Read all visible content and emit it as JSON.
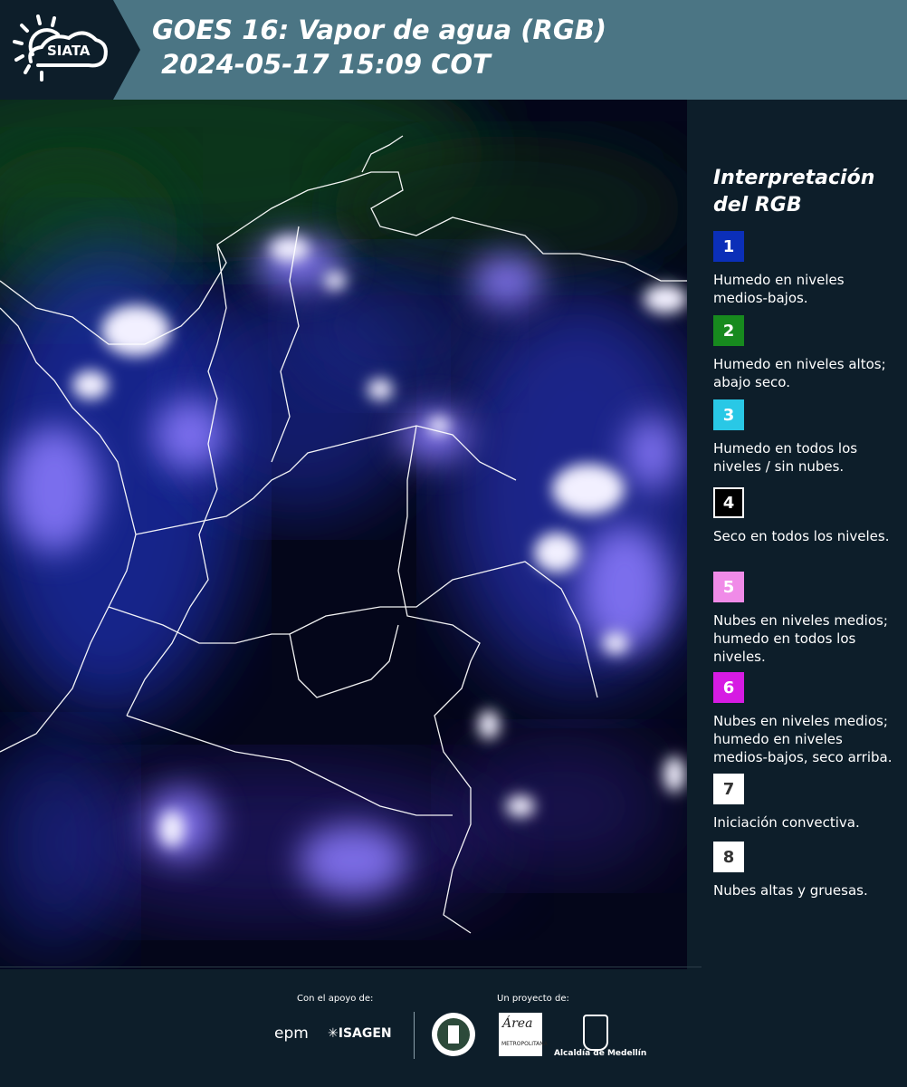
{
  "header": {
    "logo_text": "SIATA",
    "title_line1": "GOES 16: Vapor de agua (RGB)",
    "title_line2": " 2024-05-17 15:09 COT"
  },
  "legend": {
    "title_line1": "Interpretación",
    "title_line2": "del RGB",
    "items": [
      {
        "num": "1",
        "color": "#0b2fb8",
        "label": "Humedo en niveles medios-bajos."
      },
      {
        "num": "2",
        "color": "#178a1e",
        "label": "Humedo en niveles altos; abajo seco."
      },
      {
        "num": "3",
        "color": "#29c8e6",
        "label": "Humedo en todos los niveles / sin nubes."
      },
      {
        "num": "4",
        "color": "#000000",
        "label": "Seco en todos los niveles."
      },
      {
        "num": "5",
        "color": "#f08be8",
        "label": "Nubes en niveles medios; humedo en todos los niveles."
      },
      {
        "num": "6",
        "color": "#d61be3",
        "label": "Nubes en niveles medios; humedo en niveles medios-bajos, seco arriba."
      },
      {
        "num": "7",
        "color": "#ffffff",
        "label": "Iniciación convectiva."
      },
      {
        "num": "8",
        "color": "#ffffff",
        "label": "Nubes altas y gruesas."
      }
    ]
  },
  "footer": {
    "support_label": "Con el apoyo de:",
    "project_label": "Un proyecto de:",
    "sponsor1": "epm",
    "sponsor2": "ISAGEN",
    "partner1": "METROPOLITANA",
    "partner1_script": "Área",
    "partner2": "Alcaldía de Medellín"
  }
}
